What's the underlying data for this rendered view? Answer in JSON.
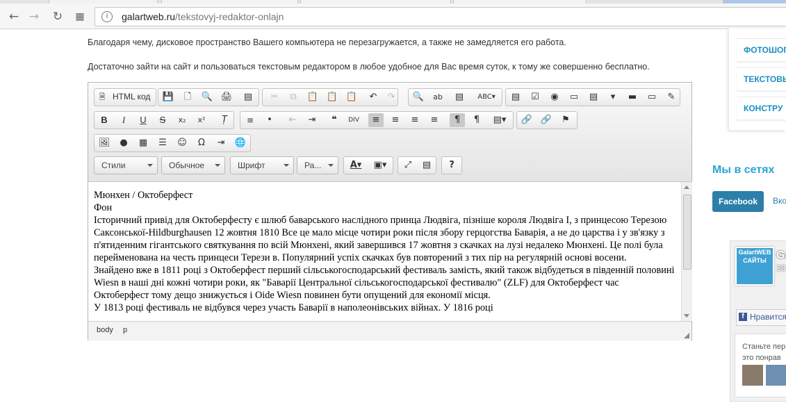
{
  "browser": {
    "url_host": "galartweb.ru",
    "url_path": "/tekstovyj-redaktor-onlajn",
    "info_icon": "info-icon",
    "back_icon": "arrow-left-icon",
    "forward_icon": "arrow-right-icon",
    "reload_icon": "reload-icon",
    "apps_icon": "apps-grid-icon"
  },
  "page": {
    "para1": "Благодаря чему, дисковое пространство Вашего компьютера не перезагружается, а также не замедляется его работа.",
    "para2": "Достаточно зайти на сайт и пользоваться текстовым редактором в любое удобное для Вас время суток, к тому же совершенно бесплатно."
  },
  "editor": {
    "source_label": "HTML код",
    "combos": {
      "styles": "Стили",
      "format": "Обычное",
      "font": "Шрифт",
      "size": "Ра..."
    },
    "content_lines": [
      "Мюнхен / Октоберфест",
      "Фон",
      "Історичний привід для Октоберфесту є шлюб баварського наслідного принца Людвіга, пізніше короля Людвіга I, з принцесою Терезою Саксонської-Hildburghausen 12 жовтня 1810 Все це мало місце чотири роки після збору герцогства Баварія, а не до царства і у зв'язку з п'ятиденним гігантського святкування по всій Мюнхені, який завершився 17 жовтня з скачках на лузі недалеко Мюнхені. Це полі була перейменована на честь принцеси Терези в. Популярний успіх скачках був повторений з тих пір на регулярній основі восени.",
      "Знайдено вже в 1811 році з Октоберфест перший сільськогосподарський фестиваль замість, який також відбудеться в південній половині Wiesn в наші дні кожні чотири роки, як \"Баварії Центральної сільськогосподарської фестивалю\" (ZLF) для Октоберфест час Октоберфест тому дещо знижується і Oide Wiesn повинен бути опущений для економії місця.",
      "У 1813 році фестиваль не відбувся через участь Баварії в наполеонівських війнах. У 1816 році"
    ],
    "status_path": [
      "body",
      "p"
    ]
  },
  "sidebar": {
    "menu": [
      "ФОТОШОП",
      "ТЕКСТОВЫ",
      "КОНСТРУ"
    ],
    "social_title": "Мы в сетях",
    "facebook_label": "Facebook",
    "vk_label": "Вкон",
    "widget": {
      "thumb_text": "GalartWEB САЙТЫ",
      "group_name": "Ga",
      "group_count": "38",
      "like_label": "Нравится",
      "join_line1": "Станьте пер",
      "join_line2": "это понрав"
    }
  }
}
